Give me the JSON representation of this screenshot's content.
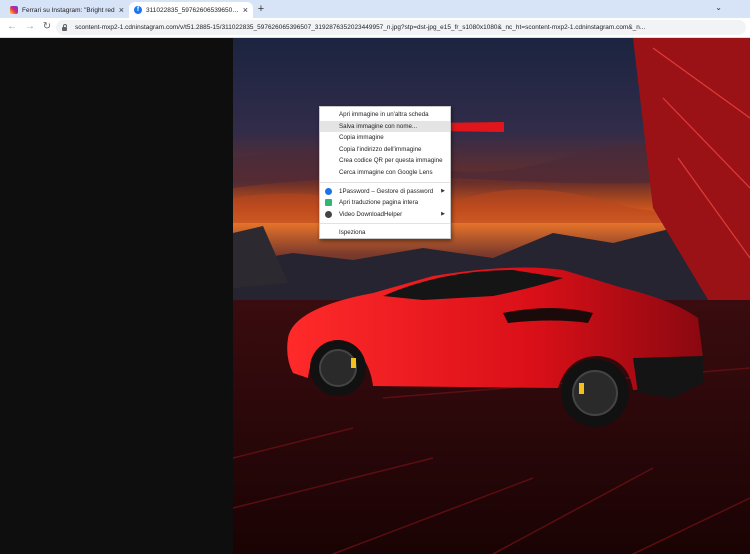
{
  "browser": {
    "tabs": [
      {
        "title": "Ferrari su Instagram: \"Bright red",
        "favicon": "instagram-icon",
        "active": false
      },
      {
        "title": "311022835_597626065396507_3192876352023449957_n.jpg",
        "favicon": "facebook-icon",
        "active": true
      }
    ],
    "new_tab_label": "+",
    "url": "scontent-mxp2-1.cdninstagram.com/v/t51.2885-15/311022835_597626065396507_3192876352023449957_n.jpg?stp=dst-jpg_e15_fr_s1080x1080&_nc_ht=scontent-mxp2-1.cdninstagram.com&_n..."
  },
  "context_menu": {
    "group1": [
      {
        "label": "Apri immagine in un'altra scheda"
      },
      {
        "label": "Salva immagine con nome...",
        "highlighted": true
      },
      {
        "label": "Copia immagine"
      },
      {
        "label": "Copia l'indirizzo dell'immagine"
      },
      {
        "label": "Crea codice QR per questa immagine"
      },
      {
        "label": "Cerca immagine con Google Lens"
      }
    ],
    "group2": [
      {
        "label": "1Password – Gestore di password",
        "icon": "1password-icon",
        "submenu": true
      },
      {
        "label": "Apri traduzione pagina intera",
        "icon": "translate-icon",
        "submenu": false
      },
      {
        "label": "Video DownloadHelper",
        "icon": "downloadhelper-icon",
        "submenu": true
      }
    ],
    "group3": [
      {
        "label": "Ispeziona"
      }
    ]
  },
  "colors": {
    "tabstrip": "#d7e3f7",
    "car_red": "#e0141c",
    "arrow_red": "#e0161c",
    "highlight": "#e4e4e4"
  }
}
